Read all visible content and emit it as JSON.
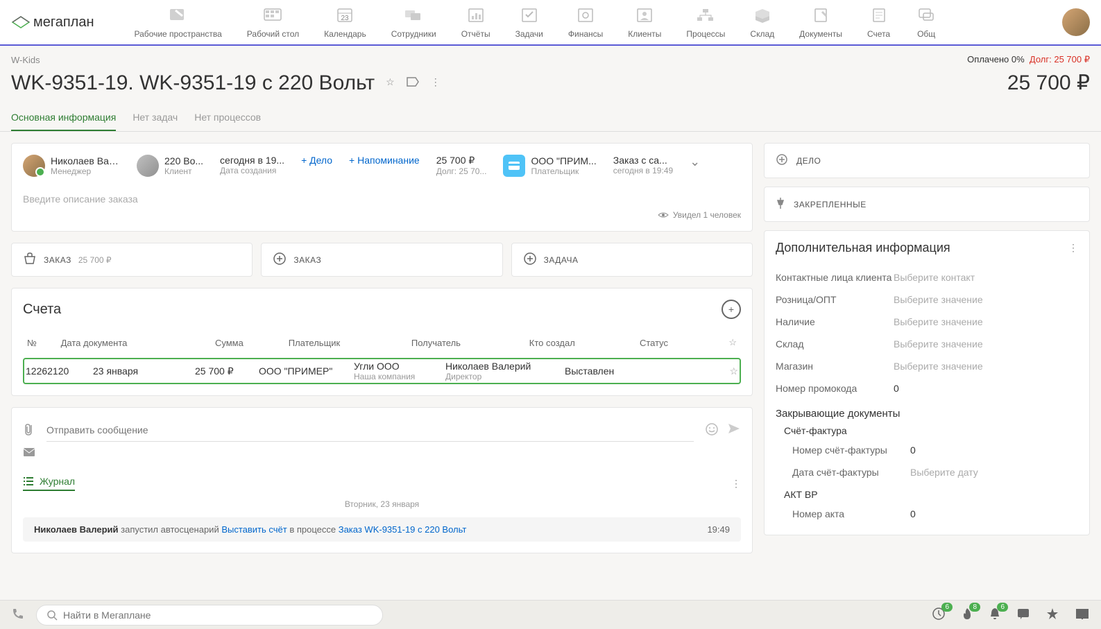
{
  "logo": "мегаплан",
  "nav": [
    {
      "label": "Рабочие пространства"
    },
    {
      "label": "Рабочий стол"
    },
    {
      "label": "Календарь",
      "badge": "23"
    },
    {
      "label": "Сотрудники"
    },
    {
      "label": "Отчёты"
    },
    {
      "label": "Задачи"
    },
    {
      "label": "Финансы"
    },
    {
      "label": "Клиенты"
    },
    {
      "label": "Процессы"
    },
    {
      "label": "Склад"
    },
    {
      "label": "Документы"
    },
    {
      "label": "Счета"
    },
    {
      "label": "Общ"
    }
  ],
  "breadcrumb": "W-Kids",
  "status": {
    "paid": "Оплачено 0%",
    "debt": "Долг: 25 700 ₽"
  },
  "title": "WK-9351-19. WK-9351-19 с 220 Вольт",
  "total": "25 700 ₽",
  "tabs": [
    {
      "label": "Основная информация",
      "active": true
    },
    {
      "label": "Нет задач"
    },
    {
      "label": "Нет процессов"
    }
  ],
  "info": {
    "manager": {
      "name": "Николаев Вале...",
      "role": "Менеджер"
    },
    "client": {
      "name": "220 Во...",
      "role": "Клиент"
    },
    "created": {
      "date": "сегодня в 19...",
      "label": "Дата создания"
    },
    "add_deal": "+ Дело",
    "add_reminder": "+ Напоминание",
    "amount": {
      "value": "25 700 ₽",
      "debt": "Долг: 25 70..."
    },
    "payer": {
      "name": "ООО \"ПРИМ...",
      "role": "Плательщик"
    },
    "order": {
      "name": "Заказ с са...",
      "date": "сегодня в 19:49"
    }
  },
  "desc_placeholder": "Введите описание заказа",
  "seen": "Увидел 1 человек",
  "actions": {
    "order": {
      "label": "ЗАКАЗ",
      "price": "25 700 ₽"
    },
    "order2": {
      "label": "ЗАКАЗ"
    },
    "task": {
      "label": "ЗАДАЧА"
    }
  },
  "invoices": {
    "title": "Счета",
    "headers": {
      "num": "№",
      "date": "Дата документа",
      "sum": "Сумма",
      "payer": "Плательщик",
      "receiver": "Получатель",
      "creator": "Кто создал",
      "status": "Статус"
    },
    "row": {
      "num": "12262120",
      "date": "23 января",
      "sum": "25 700 ₽",
      "payer": "ООО \"ПРИМЕР\"",
      "receiver": "Угли ООО",
      "receiver_sub": "Наша компания",
      "creator": "Николаев Валерий",
      "creator_sub": "Директор",
      "status": "Выставлен"
    }
  },
  "msg_placeholder": "Отправить сообщение",
  "journal": {
    "title": "Журнал",
    "date": "Вторник, 23 января",
    "entry": {
      "user": "Николаев Валерий",
      "text1": " запустил автосценарий ",
      "action": "Выставить счёт",
      "text2": " в процессе ",
      "link": "Заказ WK-9351-19 с 220 Вольт",
      "time": "19:49"
    }
  },
  "side": {
    "deal": "ДЕЛО",
    "pinned": "ЗАКРЕПЛЕННЫЕ",
    "extra_title": "Дополнительная информация",
    "fields": {
      "contacts": {
        "label": "Контактные лица клиента",
        "value": "Выберите контакт"
      },
      "retail": {
        "label": "Розница/ОПТ",
        "value": "Выберите значение"
      },
      "stock": {
        "label": "Наличие",
        "value": "Выберите значение"
      },
      "warehouse": {
        "label": "Склад",
        "value": "Выберите значение"
      },
      "shop": {
        "label": "Магазин",
        "value": "Выберите значение"
      },
      "promo": {
        "label": "Номер промокода",
        "value": "0"
      }
    },
    "closing_docs": "Закрывающие документы",
    "invoice_fact": "Счёт-фактура",
    "invoice_num": {
      "label": "Номер счёт-фактуры",
      "value": "0"
    },
    "invoice_date": {
      "label": "Дата счёт-фактуры",
      "value": "Выберите дату"
    },
    "akt": "АКТ ВР",
    "akt_num": {
      "label": "Номер акта",
      "value": "0"
    }
  },
  "search_placeholder": "Найти в Мегаплане",
  "bottom_badges": {
    "clock": "6",
    "fire": "8",
    "bell": "6"
  }
}
